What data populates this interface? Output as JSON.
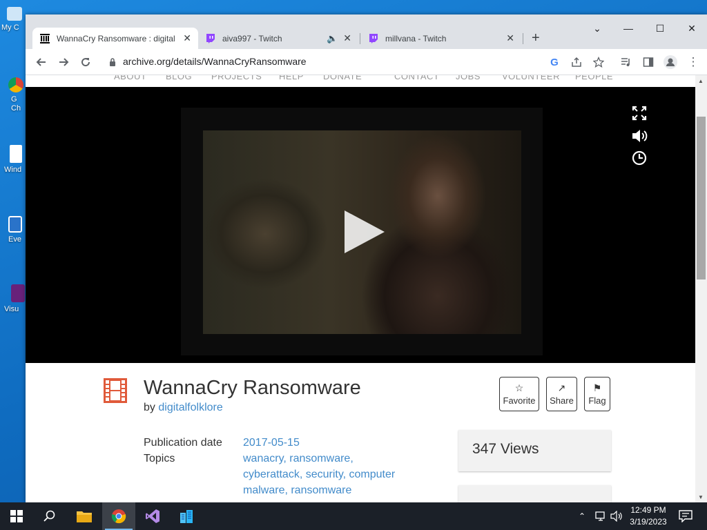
{
  "desktop": {
    "icons": [
      {
        "label": "My C"
      },
      {
        "label": "G\nCh"
      },
      {
        "label": "Wind"
      },
      {
        "label": "Eve"
      },
      {
        "label": "Visu"
      }
    ]
  },
  "browser": {
    "tabs": [
      {
        "title": "WannaCry Ransomware : digital",
        "favicon": "archive-icon",
        "active": true
      },
      {
        "title": "aiva997 - Twitch",
        "favicon": "twitch-icon",
        "audio": true
      },
      {
        "title": "millvana - Twitch",
        "favicon": "twitch-icon"
      }
    ],
    "url": "archive.org/details/WannaCryRansomware"
  },
  "page": {
    "topnav": [
      "ABOUT",
      "BLOG",
      "PROJECTS",
      "HELP",
      "DONATE",
      "CONTACT",
      "JOBS",
      "VOLUNTEER",
      "PEOPLE"
    ],
    "item": {
      "title": "WannaCry Ransomware",
      "by_prefix": "by",
      "creator": "digitalfolklore",
      "actions": {
        "favorite": "Favorite",
        "share": "Share",
        "flag": "Flag"
      },
      "publication_label": "Publication date",
      "publication_value": "2017-05-15",
      "topics_label": "Topics",
      "topics_value": "wanacry, ransomware, cyberattack, security, computer malware, ransomware",
      "views": "347 Views"
    }
  },
  "taskbar": {
    "time": "12:49 PM",
    "date": "3/19/2023"
  }
}
